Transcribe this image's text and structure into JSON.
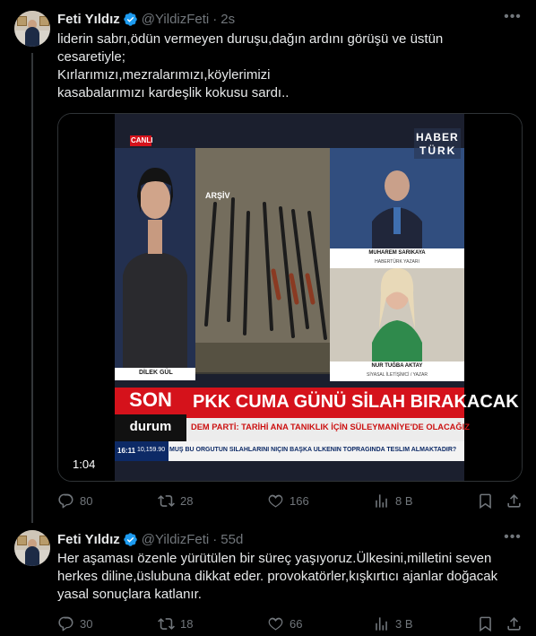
{
  "tweets": [
    {
      "author": "Feti Yıldız",
      "handle": "@YildizFeti",
      "time": "2s",
      "lines": [
        "liderin sabrı,ödün vermeyen duruşu,dağın ardını görüşü ve üstün",
        "cesaretiyle;",
        "Kırlarımızı,mezralarımızı,köylerimizi",
        "kasabalarımızı kardeşlik kokusu sardı.."
      ],
      "video": {
        "duration": "1:04",
        "canli": "CANLI",
        "arsiv": "ARŞİV",
        "channel_top": "HABER",
        "channel_bottom": "TÜRK",
        "anchor_name": "DİLEK GÜL",
        "guest1_name": "MUHAREM SARIKAYA",
        "guest1_title": "HABERTÜRK YAZARI",
        "guest2_name": "NUR TUĞBA AKTAY",
        "guest2_title": "SİYASAL İLETİŞİMCİ / YAZAR",
        "son": "SON",
        "durum": "durum",
        "headline": "PKK CUMA GÜNÜ SİLAH BIRAKACAK",
        "subhead": "DEM PARTİ: TARİHİ ANA TANIKLIK İÇİN SÜLEYMANİYE'DE OLACAĞIZ",
        "ticker": "MUŞ BU ÖRGÜTÜN SİLAHLARINI NİÇİN BAŞKA ÜLKENİN TOPRAĞINDA TESLİM ALMAKTADIR?",
        "clock": "16:11",
        "index": "10,159.90"
      },
      "replies": "80",
      "reposts": "28",
      "likes": "166",
      "views": "8 B"
    },
    {
      "author": "Feti Yıldız",
      "handle": "@YildizFeti",
      "time": "55d",
      "lines": [
        "Her aşaması özenle yürütülen bir süreç yaşıyoruz.Ülkesini,milletini seven",
        "herkes diline,üslubuna dikkat eder. provokatörler,kışkırtıcı ajanlar doğacak",
        "yasal sonuçlara katlanır."
      ],
      "replies": "30",
      "reposts": "18",
      "likes": "66",
      "views": "3 B"
    }
  ],
  "colors": {
    "background": "#000000",
    "text": "#e7e9ea",
    "muted": "#71767b",
    "verified": "#1d9bf0",
    "news_red": "#d5121b"
  },
  "icons": [
    "verified-icon",
    "more-icon",
    "reply-icon",
    "repost-icon",
    "like-icon",
    "views-icon",
    "bookmark-icon",
    "share-icon"
  ]
}
